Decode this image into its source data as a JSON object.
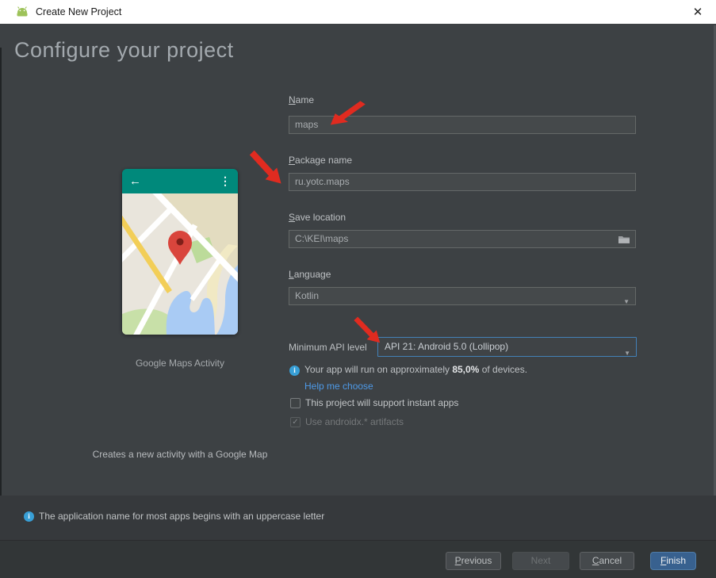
{
  "window": {
    "title": "Create New Project"
  },
  "header": {
    "title": "Configure your project"
  },
  "form": {
    "name": {
      "mnemonic": "N",
      "label_rest": "ame",
      "value": "maps"
    },
    "package": {
      "mnemonic": "P",
      "label_rest": "ackage name",
      "value": "ru.yotc.maps"
    },
    "save_location": {
      "mnemonic": "S",
      "label_rest": "ave location",
      "value": "C:\\KEI\\maps"
    },
    "language": {
      "mnemonic": "L",
      "label_rest": "anguage",
      "value": "Kotlin"
    },
    "min_api": {
      "label": "Minimum API level",
      "value": "API 21: Android 5.0 (Lollipop)"
    },
    "api_info": {
      "prefix": "Your app will run on approximately ",
      "percent": "85,0%",
      "suffix": " of devices."
    },
    "help_link": "Help me choose",
    "instant_apps": {
      "label": "This project will support instant apps",
      "checked": false
    },
    "androidx": {
      "label": "Use androidx.* artifacts",
      "checked": true
    }
  },
  "preview": {
    "caption": "Google Maps Activity",
    "description": "Creates a new activity with a Google Map"
  },
  "status_bar": {
    "message": "The application name for most apps begins with an uppercase letter"
  },
  "footer": {
    "previous": {
      "mnemonic": "P",
      "rest": "revious"
    },
    "next": {
      "label": "Next"
    },
    "cancel": {
      "mnemonic": "C",
      "rest": "ancel"
    },
    "finish": {
      "mnemonic": "F",
      "rest": "inish"
    }
  },
  "icons": {
    "back": "←",
    "menu": "⋮",
    "close": "✕",
    "info": "i",
    "check": "✓",
    "combo_arrow": "▼"
  },
  "colors": {
    "titlebar_bg": "#FFFFFF",
    "panel_bg": "#3D4144",
    "field_bg": "#45494B",
    "field_border": "#646868",
    "focus_border": "#4381B8",
    "link": "#4E9AE8",
    "info_icon": "#389FD6",
    "arrow_red": "#E02B20",
    "finish_button_bg": "#38618F",
    "appbar_teal": "#00897B",
    "android_green": "#9DC259"
  }
}
